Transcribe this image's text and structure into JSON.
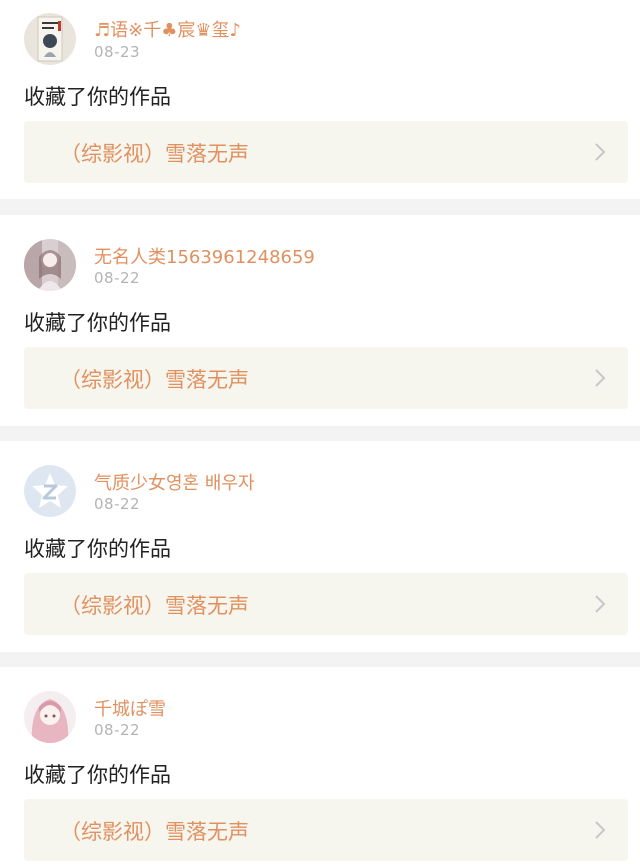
{
  "feed": {
    "items": [
      {
        "user_name": "♬语※千♣宸♛玺♪",
        "timestamp": "08-23",
        "action": "收藏了你的作品",
        "work_title": "（综影视）雪落无声",
        "avatar_icon": "book-cover-avatar"
      },
      {
        "user_name": "无名人类1563961248659",
        "timestamp": "08-22",
        "action": "收藏了你的作品",
        "work_title": "（综影视）雪落无声",
        "avatar_icon": "anime-girl-avatar"
      },
      {
        "user_name": "气质少女영혼 배우자",
        "timestamp": "08-22",
        "action": "收藏了你的作品",
        "work_title": "（综影视）雪落无声",
        "avatar_icon": "default-z-avatar"
      },
      {
        "user_name": "千城ぽ雪",
        "timestamp": "08-22",
        "action": "收藏了你的作品",
        "work_title": "（综影视）雪落无声",
        "avatar_icon": "pink-hair-girl-avatar"
      }
    ]
  },
  "colors": {
    "accent": "#e0915f",
    "background": "#f3f3f3",
    "card": "#ffffff",
    "link_bg": "#f6f5ee",
    "timestamp": "#b4b4b4",
    "text": "#222222",
    "chevron": "#c8c8c8"
  }
}
